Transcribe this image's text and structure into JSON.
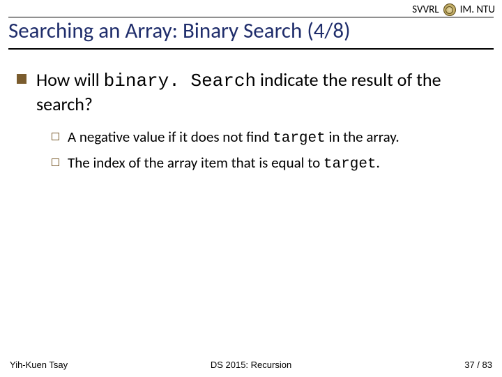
{
  "header": {
    "lab": "SVVRL",
    "inst": "IM. NTU"
  },
  "title": "Searching an Array: Binary Search (4/8)",
  "bullet1": {
    "pre": "How will ",
    "code": "binary. Search",
    "post": " indicate the result of the search?"
  },
  "sub1": {
    "pre": "A negative value if it does not find ",
    "code": "target",
    "post": " in the array."
  },
  "sub2": {
    "pre": "The index of the array item that is equal to ",
    "code": "target",
    "post": "."
  },
  "footer": {
    "author": "Yih-Kuen Tsay",
    "course": "DS 2015: Recursion",
    "page": "37 / 83"
  }
}
